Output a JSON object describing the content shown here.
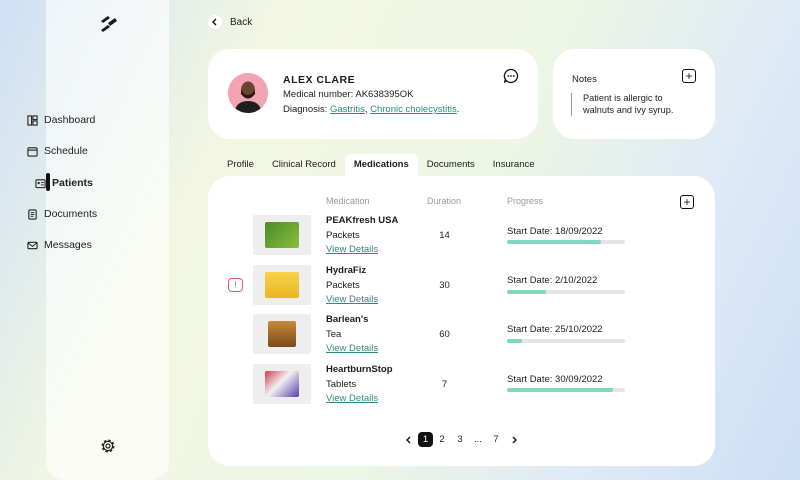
{
  "sidebar": {
    "items": [
      {
        "label": "Dashboard"
      },
      {
        "label": "Schedule"
      },
      {
        "label": "Patients"
      },
      {
        "label": "Documents"
      },
      {
        "label": "Messages"
      }
    ]
  },
  "back_label": "Back",
  "patient": {
    "name": "ALEX CLARE",
    "medical_number_label": "Medical number:",
    "medical_number": "AK638395OK",
    "diagnosis_label": "Diagnosis:",
    "diagnosis_1": "Gastritis",
    "diagnosis_sep": ",",
    "diagnosis_2": "Chronic cholecystitis",
    "diagnosis_end": "."
  },
  "notes": {
    "title": "Notes",
    "text": "Patient is allergic to walnuts and ivy syrup."
  },
  "tabs": [
    {
      "label": "Profile"
    },
    {
      "label": "Clinical Record"
    },
    {
      "label": "Medications"
    },
    {
      "label": "Documents"
    },
    {
      "label": "Insurance"
    }
  ],
  "table": {
    "col_medication": "Medication",
    "col_duration": "Duration",
    "col_progress": "Progress",
    "rows": [
      {
        "name": "PEAKfresh USA",
        "type": "Packets",
        "link": "View Details",
        "duration": "14",
        "start": "Start Date: 18/09/2022",
        "progress": 0.8
      },
      {
        "name": "HydraFiz",
        "type": "Packets",
        "link": "View Details",
        "duration": "30",
        "start": "Start Date: 2/10/2022",
        "progress": 0.33
      },
      {
        "name": "Barlean's",
        "type": "Tea",
        "link": "View Details",
        "duration": "60",
        "start": "Start Date: 25/10/2022",
        "progress": 0.13
      },
      {
        "name": "HeartburnStop",
        "type": "Tablets",
        "link": "View Details",
        "duration": "7",
        "start": "Start Date: 30/09/2022",
        "progress": 0.9
      }
    ]
  },
  "alert_symbol": "!",
  "pagination": {
    "pages": [
      "1",
      "2",
      "3",
      "...",
      "7"
    ],
    "current": "1"
  },
  "colors": {
    "accent_teal": "#7fd7c4",
    "link": "#2c8a7f",
    "alert": "#e05b5b"
  }
}
